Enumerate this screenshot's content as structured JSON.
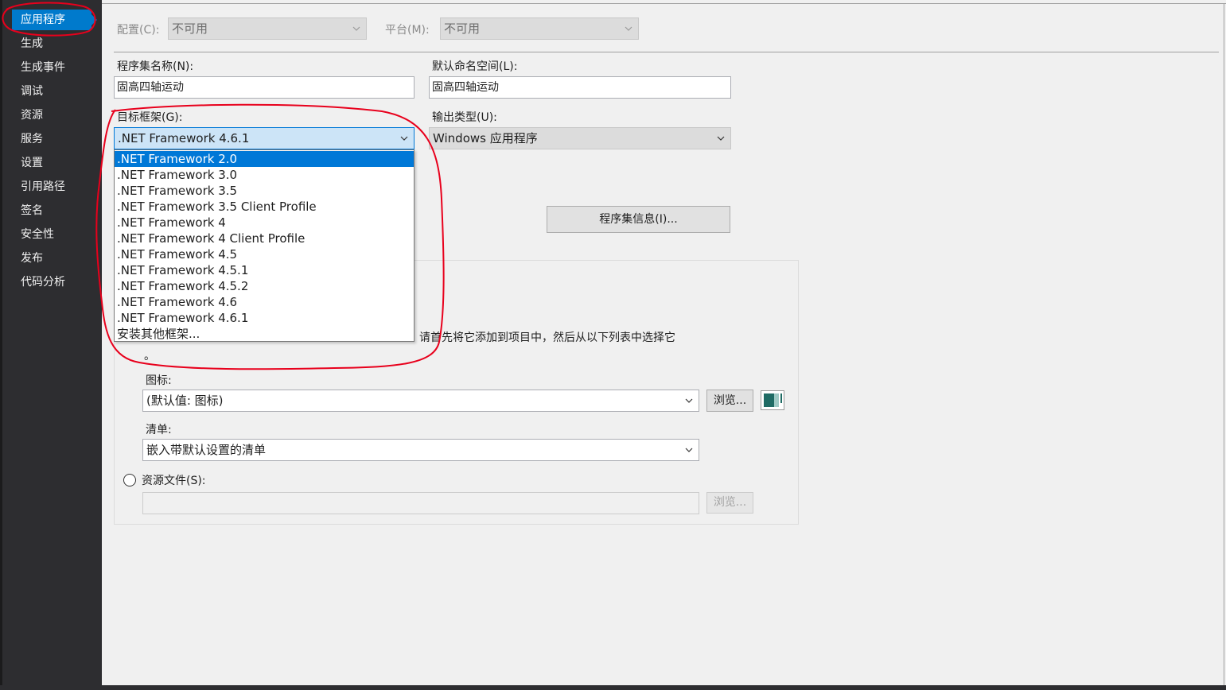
{
  "sidebar": {
    "items": [
      {
        "label": "应用程序",
        "selected": true
      },
      {
        "label": "生成"
      },
      {
        "label": "生成事件"
      },
      {
        "label": "调试"
      },
      {
        "label": "资源"
      },
      {
        "label": "服务"
      },
      {
        "label": "设置"
      },
      {
        "label": "引用路径"
      },
      {
        "label": "签名"
      },
      {
        "label": "安全性"
      },
      {
        "label": "发布"
      },
      {
        "label": "代码分析"
      }
    ]
  },
  "toolbar": {
    "config_label": "配置(C):",
    "config_value": "不可用",
    "platform_label": "平台(M):",
    "platform_value": "不可用"
  },
  "form": {
    "assembly_name_label": "程序集名称(N):",
    "assembly_name_value": "固高四轴运动",
    "default_namespace_label": "默认命名空间(L):",
    "default_namespace_value": "固高四轴运动",
    "target_framework_label": "目标框架(G):",
    "target_framework_value": ".NET Framework 4.6.1",
    "output_type_label": "输出类型(U):",
    "output_type_value": "Windows 应用程序",
    "assembly_info_button": "程序集信息(I)...",
    "framework_options": [
      ".NET Framework 2.0",
      ".NET Framework 3.0",
      ".NET Framework 3.5",
      ".NET Framework 3.5 Client Profile",
      ".NET Framework 4",
      ".NET Framework 4 Client Profile",
      ".NET Framework 4.5",
      ".NET Framework 4.5.1",
      ".NET Framework 4.5.2",
      ".NET Framework 4.6",
      ".NET Framework 4.6.1",
      "安装其他框架..."
    ],
    "framework_highlighted_index": 0
  },
  "resources": {
    "hint_text": "请首先将它添加到项目中，然后从以下列表中选择它",
    "hint_tail": "。",
    "icon_label": "图标:",
    "icon_value": "(默认值: 图标)",
    "browse_button": "浏览...",
    "manifest_label": "清单:",
    "manifest_value": "嵌入带默认设置的清单",
    "resource_file_label": "资源文件(S):",
    "resource_file_value": "",
    "resource_browse_button": "浏览..."
  },
  "colors": {
    "sidebar_bg": "#2d2d30",
    "accent": "#007acc",
    "annotation": "#e8001c"
  }
}
